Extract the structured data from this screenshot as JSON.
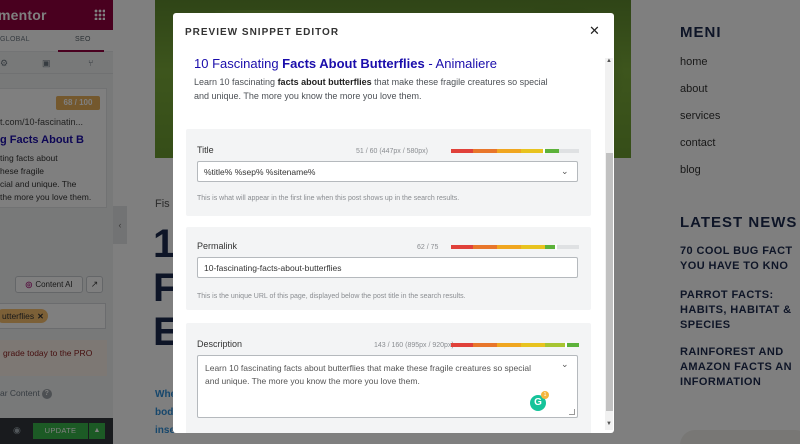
{
  "elementor": {
    "logo": "mentor",
    "tabs": [
      "GLOBAL",
      "SEO"
    ],
    "seo_score": "68 / 100",
    "preview_url": "t.com/10-fascinatin...",
    "preview_title": "g Facts About B",
    "preview_desc": "ting facts about\nhese fragile\ncial and unique. The\nthe more you love them.",
    "content_ai_label": "Content AI",
    "keyword_chip": "utterflies",
    "upgrade_text": "grade today to the PRO",
    "lars_label": "ar Content",
    "update_label": "UPDATE"
  },
  "website": {
    "category": "Fis",
    "heading_letters": "1\nF\nE",
    "body_text": "Whe\nbod\ninse",
    "sidebar_menu_title": "MENI",
    "menu_items": [
      "home",
      "about",
      "services",
      "contact",
      "blog"
    ],
    "latest_news_title": "LATEST NEWS",
    "news_items": [
      "70 COOL BUG FACT\nYOU HAVE TO KNO",
      "PARROT FACTS:\nHABITS, HABITAT &\nSPECIES",
      "RAINFOREST AND\nAMAZON FACTS AN\nINFORMATION"
    ]
  },
  "modal": {
    "title": "PREVIEW SNIPPET EDITOR",
    "serp": {
      "title_prefix": "10 Fascinating ",
      "title_bold": "Facts About Butterflies",
      "title_suffix": " - Animaliere",
      "desc_prefix": "Learn 10 fascinating ",
      "desc_bold": "facts about butterflies",
      "desc_suffix": " that make these fragile creatures so special and unique. The more you know the more you love them."
    },
    "title_field": {
      "label": "Title",
      "count": "51 / 60 (447px / 580px)",
      "value": "%title% %sep% %sitename%",
      "hint": "This is what will appear in the first line when this post shows up in the search results."
    },
    "permalink_field": {
      "label": "Permalink",
      "count": "62 / 75",
      "value": "10-fascinating-facts-about-butterflies",
      "hint": "This is the unique URL of this page, displayed below the post title in the search results."
    },
    "description_field": {
      "label": "Description",
      "count": "143 / 160 (895px / 920px)",
      "value": "Learn 10 fascinating facts about butterflies that make these fragile creatures so special and unique. The more you know the more you love them.",
      "grammarly_count": "1"
    },
    "meter_colors": [
      "#e0413a",
      "#e8762b",
      "#f0a620",
      "#e8c31f",
      "#a7c532",
      "#5cb23a"
    ]
  },
  "icons": {
    "close": "close-icon",
    "chevron": "chevron-down-icon",
    "grammarly": "grammarly-icon",
    "eye": "eye-icon"
  }
}
